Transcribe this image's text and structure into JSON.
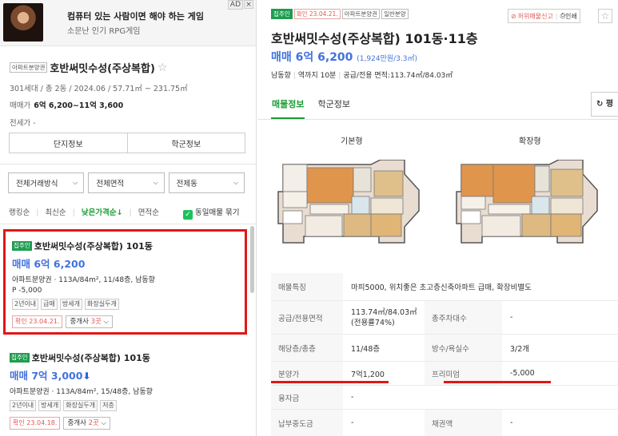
{
  "ad": {
    "title": "컴퓨터 있는 사람이면 해야 하는 게임",
    "subtitle": "소문난 인기 RPG게임",
    "ad_badge": "AD",
    "close": "×"
  },
  "complex": {
    "type_tag": "아파트분양권",
    "name": "호반써밋수성(주상복합)",
    "info": "301세대 / 총 2동 / 2024.06 / 57.71㎡ ~ 231.75㎡",
    "sale_label": "매매가",
    "sale_range": "6억 6,200~11억 3,600",
    "jeonse": "전세가 -"
  },
  "left_tabs": [
    "단지정보",
    "학군정보"
  ],
  "filters": [
    "전체거래방식",
    "전체면적",
    "전체동"
  ],
  "sorts": {
    "items": [
      "랭킹순",
      "최신순",
      "낮은가격순↓",
      "면적순"
    ],
    "same_listing": "동일매물 묶기"
  },
  "listings": [
    {
      "badge": "집주인",
      "title": "호반써밋수성(주상복합) 101동",
      "price": "매매 6억 6,200",
      "desc": "아파트분양권 · 113A/84m², 11/48층, 남동향",
      "premium": "P -5,000",
      "chips": [
        "2년이내",
        "급매",
        "방세개",
        "화장실두개"
      ],
      "confirm": "확인 23.04.21.",
      "agents_prefix": "중개사 ",
      "agents_count": "3곳"
    },
    {
      "badge": "집주인",
      "title": "호반써밋수성(주상복합) 101동",
      "price": "매매 7억 3,000",
      "desc": "아파트분양권 · 113A/84m², 15/48층, 남동향",
      "chips": [
        "2년이내",
        "방세개",
        "화장실두개",
        "저층"
      ],
      "confirm": "확인 23.04.18.",
      "agents_prefix": "중개사 ",
      "agents_count": "2곳"
    }
  ],
  "detail": {
    "badges": [
      "집주인",
      "확인 23.04.21.",
      "아파트분양권",
      "일반분양"
    ],
    "report": "허위매물신고",
    "print": "인쇄",
    "title": "호반써밋수성(주상복합) 101동·11층",
    "price": "매매 6억 6,200",
    "price_per": "(1,924만원/3.3㎡)",
    "meta": [
      "남동향",
      "역까지 10분",
      "공급/전용 면적:113.74㎡/84.03㎡"
    ],
    "tabs": [
      "매물정보",
      "학군정보"
    ],
    "refresh": "평",
    "plans": [
      "기본형",
      "확장형"
    ],
    "table": {
      "features_label": "매물특징",
      "features_value": "마피5000, 위치좋은 초고층신축아파트 급매, 확장비별도",
      "rows": [
        {
          "l1": "공급/전용면적",
          "v1": "113.74㎡/84.03㎡(전용률74%)",
          "l2": "총주차대수",
          "v2": "-"
        },
        {
          "l1": "해당층/총층",
          "v1": "11/48층",
          "l2": "방수/욕실수",
          "v2": "3/2개"
        },
        {
          "l1": "분양가",
          "v1": "7억1,200",
          "l2": "프리미엄",
          "v2": "-5,000"
        }
      ],
      "loan_label": "융자금",
      "loan_value": "-",
      "last": {
        "l1": "납부중도금",
        "v1": "-",
        "l2": "채권액",
        "v2": "-"
      }
    }
  },
  "colors": {
    "accent_green": "#1c9c36",
    "price_blue": "#4172dd",
    "highlight_red": "#e11717"
  }
}
